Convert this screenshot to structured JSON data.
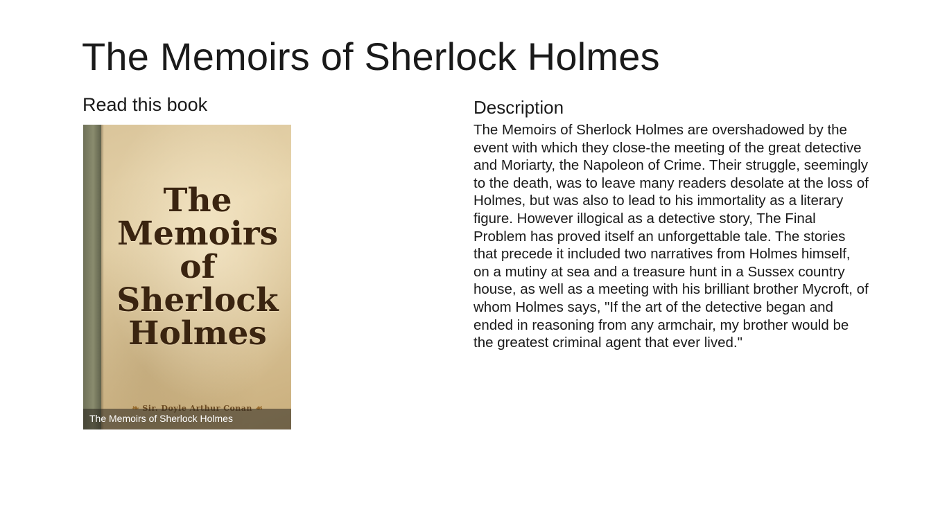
{
  "page": {
    "title": "The Memoirs of Sherlock Holmes"
  },
  "read_section": {
    "heading": "Read this book",
    "book": {
      "cover_title": "The\nMemoirs\nof\nSherlock\nHolmes",
      "cover_author": "Sir. Doyle Arthur Conan",
      "caption": "The Memoirs of Sherlock Holmes"
    }
  },
  "description": {
    "heading": "Description",
    "text": "The Memoirs of Sherlock Holmes are overshadowed by the event with which they close-the meeting of the great detective and Moriarty, the Napoleon of Crime. Their struggle, seemingly to the death, was to leave many readers desolate at the loss of Holmes, but was also to lead to his immortality as a literary figure. However illogical as a detective story, The Final Problem has proved itself an unforgettable tale. The stories that precede it included two narratives from Holmes himself, on a mutiny at sea and a treasure hunt in a Sussex country house, as well as a meeting with his brilliant brother Mycroft, of whom Holmes says, \"If the art of the detective began and ended in reasoning from any armchair, my brother would be the greatest criminal agent that ever lived.\""
  }
}
